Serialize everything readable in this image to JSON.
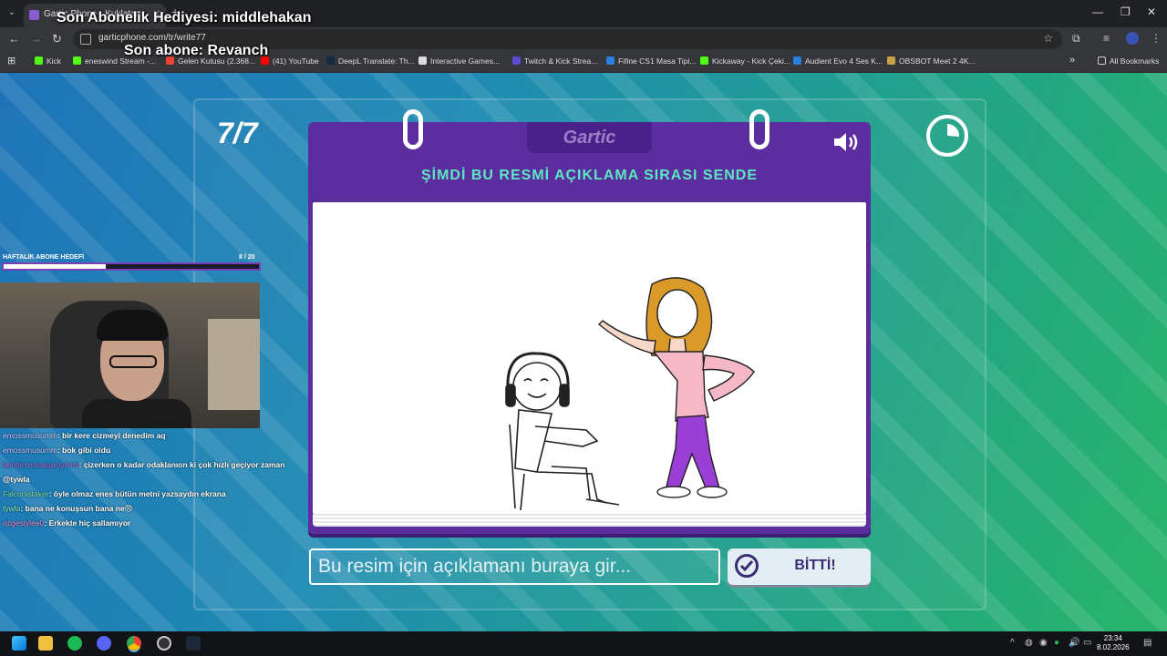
{
  "browser": {
    "tab_title": "Gartic Phone - Kuklatan Kulele",
    "url": "garticphone.com/tr/write77",
    "bookmarks": [
      "Kick",
      "eneswind Stream -...",
      "Gelen Kutusu (2.368...",
      "(41) YouTube",
      "DeepL Translate: Th...",
      "Interactive Games...",
      "Twitch & Kick Strea...",
      "Fifine CS1 Masa Tipi...",
      "Kickaway - Kick Çeki...",
      "Audient Evo 4 Ses K...",
      "OBSBOT Meet 2 4K..."
    ],
    "all_bookmarks": "All Bookmarks"
  },
  "overlay": {
    "gift": "Son Abonelik Hediyesi: middlehakan",
    "last_sub": "Son abone: Revanch",
    "sub_goal_title": "HAFTALIK ABONE HEDEFİ",
    "sub_goal_count": "8 / 20",
    "sub_goal_progress": 0.4
  },
  "chat": [
    {
      "user": "emossmusumm",
      "msg": ": bir kere cizmeyi denedim aq",
      "color": "#c9c9ff"
    },
    {
      "user": "emossmusumm",
      "msg": ": bok gibi oldu",
      "color": "#c9c9ff"
    },
    {
      "user": "benbircevizagaciyimm",
      "msg": ": çizerken o kadar odaklanıon ki çok hızlı geçiyor zaman @tywla",
      "color": "#b069d9"
    },
    {
      "user": "Falconistaker",
      "msg": ": öyle olmaz enes bütün metni yazsaydın ekrana",
      "color": "#7fe3a8"
    },
    {
      "user": "tywla",
      "msg": ": bana ne konuşsun bana ne😠",
      "color": "#8cf0c0"
    },
    {
      "user": "ozgestylee0",
      "msg": ": Erkekte hiç sallamıyor",
      "color": "#f28ad6"
    }
  ],
  "game": {
    "round": "7/7",
    "logo": "Gartic",
    "prompt": "ŞİMDİ BU RESMİ AÇIKLAMA SIRASI SENDE",
    "input_placeholder": "Bu resim için açıklamanı buraya gir...",
    "done_label": "BİTTİ!",
    "timer_fraction": 0.26
  },
  "taskbar": {
    "time": "23:34",
    "date": "8.02.2026"
  },
  "colors": {
    "card_purple": "#5b2d9e",
    "prompt_teal": "#5ce8c0",
    "button_bg": "#e3eef4"
  }
}
